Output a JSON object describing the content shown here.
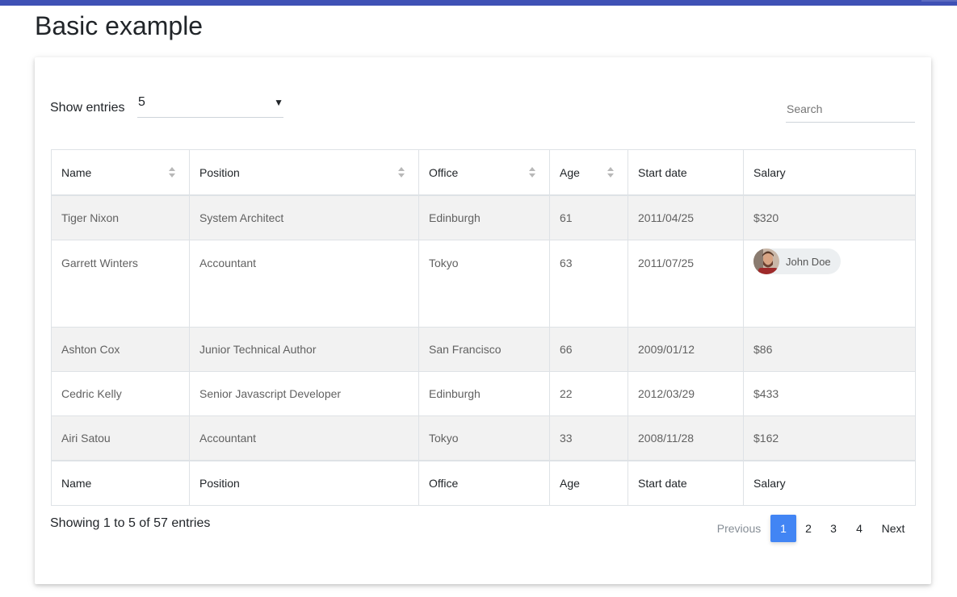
{
  "page": {
    "title": "Basic example"
  },
  "controls": {
    "show_entries_label": "Show entries",
    "entries_value": "5",
    "search_placeholder": "Search"
  },
  "table": {
    "columns": [
      "Name",
      "Position",
      "Office",
      "Age",
      "Start date",
      "Salary"
    ],
    "footer_columns": [
      "Name",
      "Position",
      "Office",
      "Age",
      "Start date",
      "Salary"
    ],
    "rows": [
      {
        "name": "Tiger Nixon",
        "position": "System Architect",
        "office": "Edinburgh",
        "age": "61",
        "start_date": "2011/04/25",
        "salary": "$320"
      },
      {
        "name": "Garrett Winters",
        "position": "Accountant",
        "office": "Tokyo",
        "age": "63",
        "start_date": "2011/07/25",
        "salary_chip": "John Doe"
      },
      {
        "name": "Ashton Cox",
        "position": "Junior Technical Author",
        "office": "San Francisco",
        "age": "66",
        "start_date": "2009/01/12",
        "salary": "$86"
      },
      {
        "name": "Cedric Kelly",
        "position": "Senior Javascript Developer",
        "office": "Edinburgh",
        "age": "22",
        "start_date": "2012/03/29",
        "salary": "$433"
      },
      {
        "name": "Airi Satou",
        "position": "Accountant",
        "office": "Tokyo",
        "age": "33",
        "start_date": "2008/11/28",
        "salary": "$162"
      }
    ]
  },
  "info": {
    "showing": "Showing 1 to 5 of 57 entries"
  },
  "pagination": {
    "previous": "Previous",
    "pages": [
      "1",
      "2",
      "3",
      "4"
    ],
    "next": "Next"
  },
  "colors": {
    "accent": "#4285f4",
    "topbar": "#3f51b5",
    "stripe": "#f2f2f2"
  },
  "icons": {
    "sort": "sort-icon",
    "caret": "caret-down-icon",
    "avatar": "avatar-icon"
  }
}
